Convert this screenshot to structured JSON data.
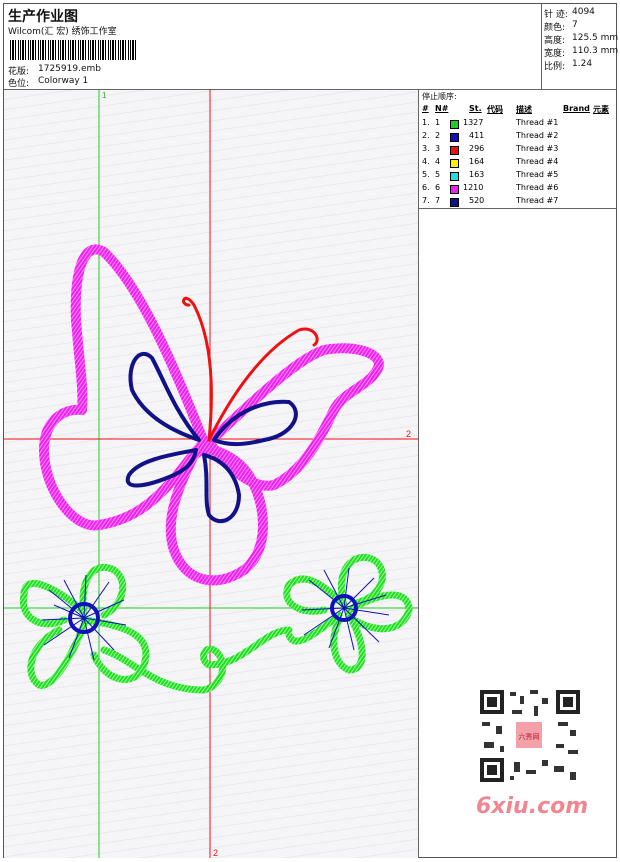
{
  "header": {
    "title": "生产作业图",
    "company": "Wilcom(汇 宏) 绣饰工作室",
    "design_label": "花版:",
    "design_value": "1725919.emb",
    "colorway_label": "色位:",
    "colorway_value": "Colorway 1"
  },
  "stats": [
    {
      "label": "针 迹:",
      "value": "4094"
    },
    {
      "label": "颜色:",
      "value": "7"
    },
    {
      "label": "高度:",
      "value": "125.5 mm"
    },
    {
      "label": "宽度:",
      "value": "110.3 mm"
    },
    {
      "label": "比例:",
      "value": "1.24"
    }
  ],
  "sequence": {
    "heading": "停止顺序:",
    "columns": [
      "#",
      "N#",
      "St.",
      "代码",
      "描述",
      "Brand",
      "元素"
    ],
    "rows": [
      {
        "num": "1.",
        "n": "1",
        "color": "#22cc22",
        "st": "1327",
        "desc": "Thread #1"
      },
      {
        "num": "2.",
        "n": "2",
        "color": "#1111bb",
        "st": "411",
        "desc": "Thread #2"
      },
      {
        "num": "3.",
        "n": "3",
        "color": "#ee1111",
        "st": "296",
        "desc": "Thread #3"
      },
      {
        "num": "4.",
        "n": "4",
        "color": "#ffee00",
        "st": "164",
        "desc": "Thread #4"
      },
      {
        "num": "5.",
        "n": "5",
        "color": "#22dddd",
        "st": "163",
        "desc": "Thread #5"
      },
      {
        "num": "6.",
        "n": "6",
        "color": "#ee22ee",
        "st": "1210",
        "desc": "Thread #6"
      },
      {
        "num": "7.",
        "n": "7",
        "color": "#111188",
        "st": "520",
        "desc": "Thread #7"
      }
    ]
  },
  "guides": {
    "v1_label": "1",
    "h2_label": "2",
    "v2_label": "2"
  },
  "watermark": "6xiu.com",
  "qr_badge": "六秀网"
}
